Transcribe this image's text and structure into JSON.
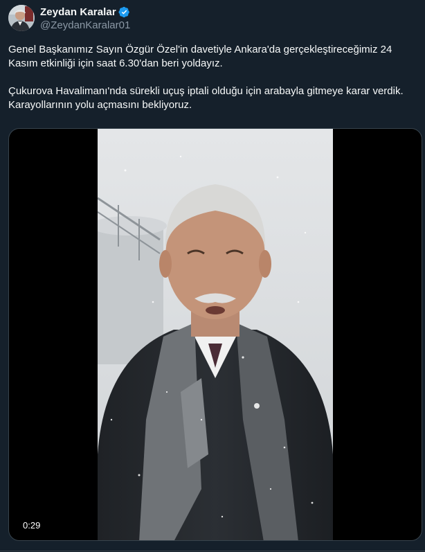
{
  "author": {
    "display_name": "Zeydan Karalar",
    "handle": "@ZeydanKaralar01",
    "verified_icon": "verified-badge-icon",
    "verified_color": "#1d9bf0"
  },
  "tweet": {
    "paragraph_1": "Genel Başkanımız Sayın Özgür Özel'in davetiyle Ankara'da gerçekleştireceğimiz 24 Kasım etkinliği için saat 6.30'dan beri yoldayız.",
    "paragraph_2": "Çukurova Havalimanı'nda sürekli uçuş iptali olduğu için arabayla gitmeye karar verdik. Karayollarının yolu açmasını bekliyoruz."
  },
  "media": {
    "type": "video",
    "duration": "0:29"
  },
  "colors": {
    "background": "#15202b",
    "text_primary": "#f7f9f9",
    "text_secondary": "#8b98a5",
    "border": "#38444d"
  }
}
